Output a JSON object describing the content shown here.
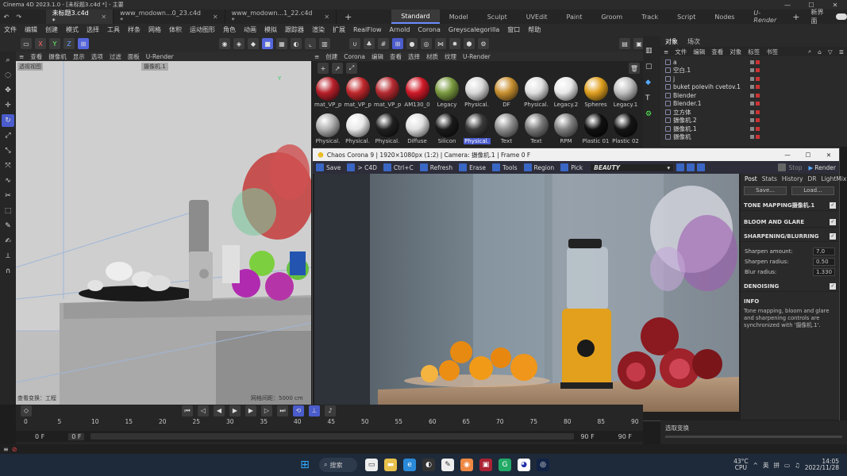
{
  "window": {
    "title": "Cinema 4D 2023.1.0 - [未标题3.c4d *] - 主要"
  },
  "doc_tabs": [
    {
      "label": "未标题3.c4d *"
    },
    {
      "label": "www_modown...0_23.c4d *"
    },
    {
      "label": "www_modown...1_22.c4d *"
    }
  ],
  "layout_tabs": [
    "Standard",
    "Model",
    "Sculpt",
    "UVEdit",
    "Paint",
    "Groom",
    "Track",
    "Script",
    "Nodes",
    "U-Render"
  ],
  "new_interface": "新界面",
  "menu": [
    "文件",
    "编辑",
    "创建",
    "模式",
    "选择",
    "工具",
    "样条",
    "网格",
    "体积",
    "运动图形",
    "角色",
    "动画",
    "模拟",
    "跟踪器",
    "渲染",
    "扩展",
    "RealFlow",
    "Arnold",
    "Corona",
    "Greyscalegorilla",
    "窗口",
    "帮助"
  ],
  "viewport": {
    "menu": [
      "查看",
      "摄像机",
      "显示",
      "选项",
      "过滤",
      "面板",
      "U-Render"
    ],
    "label_top": "透视视图",
    "camera": "摄像机.1",
    "status_left": "查看变换：工程",
    "status_right": "网格间距：5000 cm",
    "axis": "Y"
  },
  "material_menu": [
    "创建",
    "Corona",
    "编辑",
    "查看",
    "选择",
    "材质",
    "纹理",
    "U-Render"
  ],
  "materials": [
    {
      "label": "mat_VP_p",
      "color": "#b8202a"
    },
    {
      "label": "mat_VP_p",
      "color": "#c0282c"
    },
    {
      "label": "mat_VP_p",
      "color": "#b52a30"
    },
    {
      "label": "AM130_0",
      "color": "#d01a28"
    },
    {
      "label": "Legacy",
      "color": "#7a9a40"
    },
    {
      "label": "Physical.",
      "color": "#d8d8d8"
    },
    {
      "label": "DF",
      "color": "#c89030"
    },
    {
      "label": "Physical.",
      "color": "#e0e0e0"
    },
    {
      "label": "Legacy.2",
      "color": "#e8e8e8"
    },
    {
      "label": "Spheres",
      "color": "#e0a020"
    },
    {
      "label": "Legacy.1",
      "color": "#c0c0c0"
    },
    {
      "label": "Physical.",
      "color": "#b0b0b0"
    },
    {
      "label": "Physical.",
      "color": "#e8e8e8"
    },
    {
      "label": "Physical.",
      "color": "#202020"
    },
    {
      "label": "Diffuse",
      "color": "#e0e0e0"
    },
    {
      "label": "Silicon",
      "color": "#1a1a1a"
    },
    {
      "label": "Physical.",
      "color": "#3a3a3a"
    },
    {
      "label": "Text",
      "color": "#909090"
    },
    {
      "label": "Text",
      "color": "#7a7a7a"
    },
    {
      "label": "RPM",
      "color": "#808080"
    },
    {
      "label": "Plastic 01",
      "color": "#101010"
    },
    {
      "label": "Plastic 02",
      "color": "#151515"
    }
  ],
  "object_panel": {
    "tabs": [
      "对象",
      "场次"
    ],
    "menu": [
      "文件",
      "编辑",
      "查看",
      "对象",
      "标签",
      "书签"
    ],
    "objects": [
      {
        "name": "a"
      },
      {
        "name": "空白.1"
      },
      {
        "name": "j"
      },
      {
        "name": "buket polevih cvetov.1"
      },
      {
        "name": "Blender"
      },
      {
        "name": "Blender.1"
      },
      {
        "name": "立方体"
      },
      {
        "name": "摄像机.2"
      },
      {
        "name": "摄像机.1"
      },
      {
        "name": "摄像机"
      }
    ]
  },
  "corona": {
    "title": "Chaos Corona 9 | 1920×1080px (1:2) | Camera: 摄像机.1 | Frame 0 F",
    "toolbar": [
      "Save",
      "> C4D",
      "Ctrl+C",
      "Refresh",
      "Erase",
      "Tools",
      "Region",
      "Pick"
    ],
    "pass": "BEAUTY",
    "stop": "Stop",
    "render": "Render",
    "side_tabs": [
      "Post",
      "Stats",
      "History",
      "DR",
      "LightMix"
    ],
    "save_btn": "Save...",
    "load_btn": "Load...",
    "tone_mapping": "TONE MAPPING摄像机.1",
    "bloom": "BLOOM AND GLARE",
    "sharpening": "SHARPENING/BLURRING",
    "sharpen_amount_label": "Sharpen amount:",
    "sharpen_amount": "7.0",
    "sharpen_radius_label": "Sharpen radius:",
    "sharpen_radius": "0.50",
    "blur_radius_label": "Blur radius:",
    "blur_radius": "1.330",
    "denoising": "DENOISING",
    "info_title": "INFO",
    "info_text": "Tone mapping, bloom and glare and sharpening controls are synchronized with '摄像机.1'."
  },
  "timeline": {
    "ticks": [
      "0",
      "5",
      "10",
      "15",
      "20",
      "25",
      "30",
      "35",
      "40",
      "45",
      "50",
      "55",
      "60",
      "65",
      "70",
      "75",
      "80",
      "85",
      "90"
    ],
    "start": "0 F",
    "current": "0 F",
    "end": "90 F",
    "end2": "90 F"
  },
  "attr_label": "选取变换",
  "taskbar": {
    "search": "搜索",
    "temp": "43°C",
    "cpu": "CPU",
    "lang1": "英",
    "lang2": "拼",
    "time": "14:05",
    "date": "2022/11/28"
  }
}
